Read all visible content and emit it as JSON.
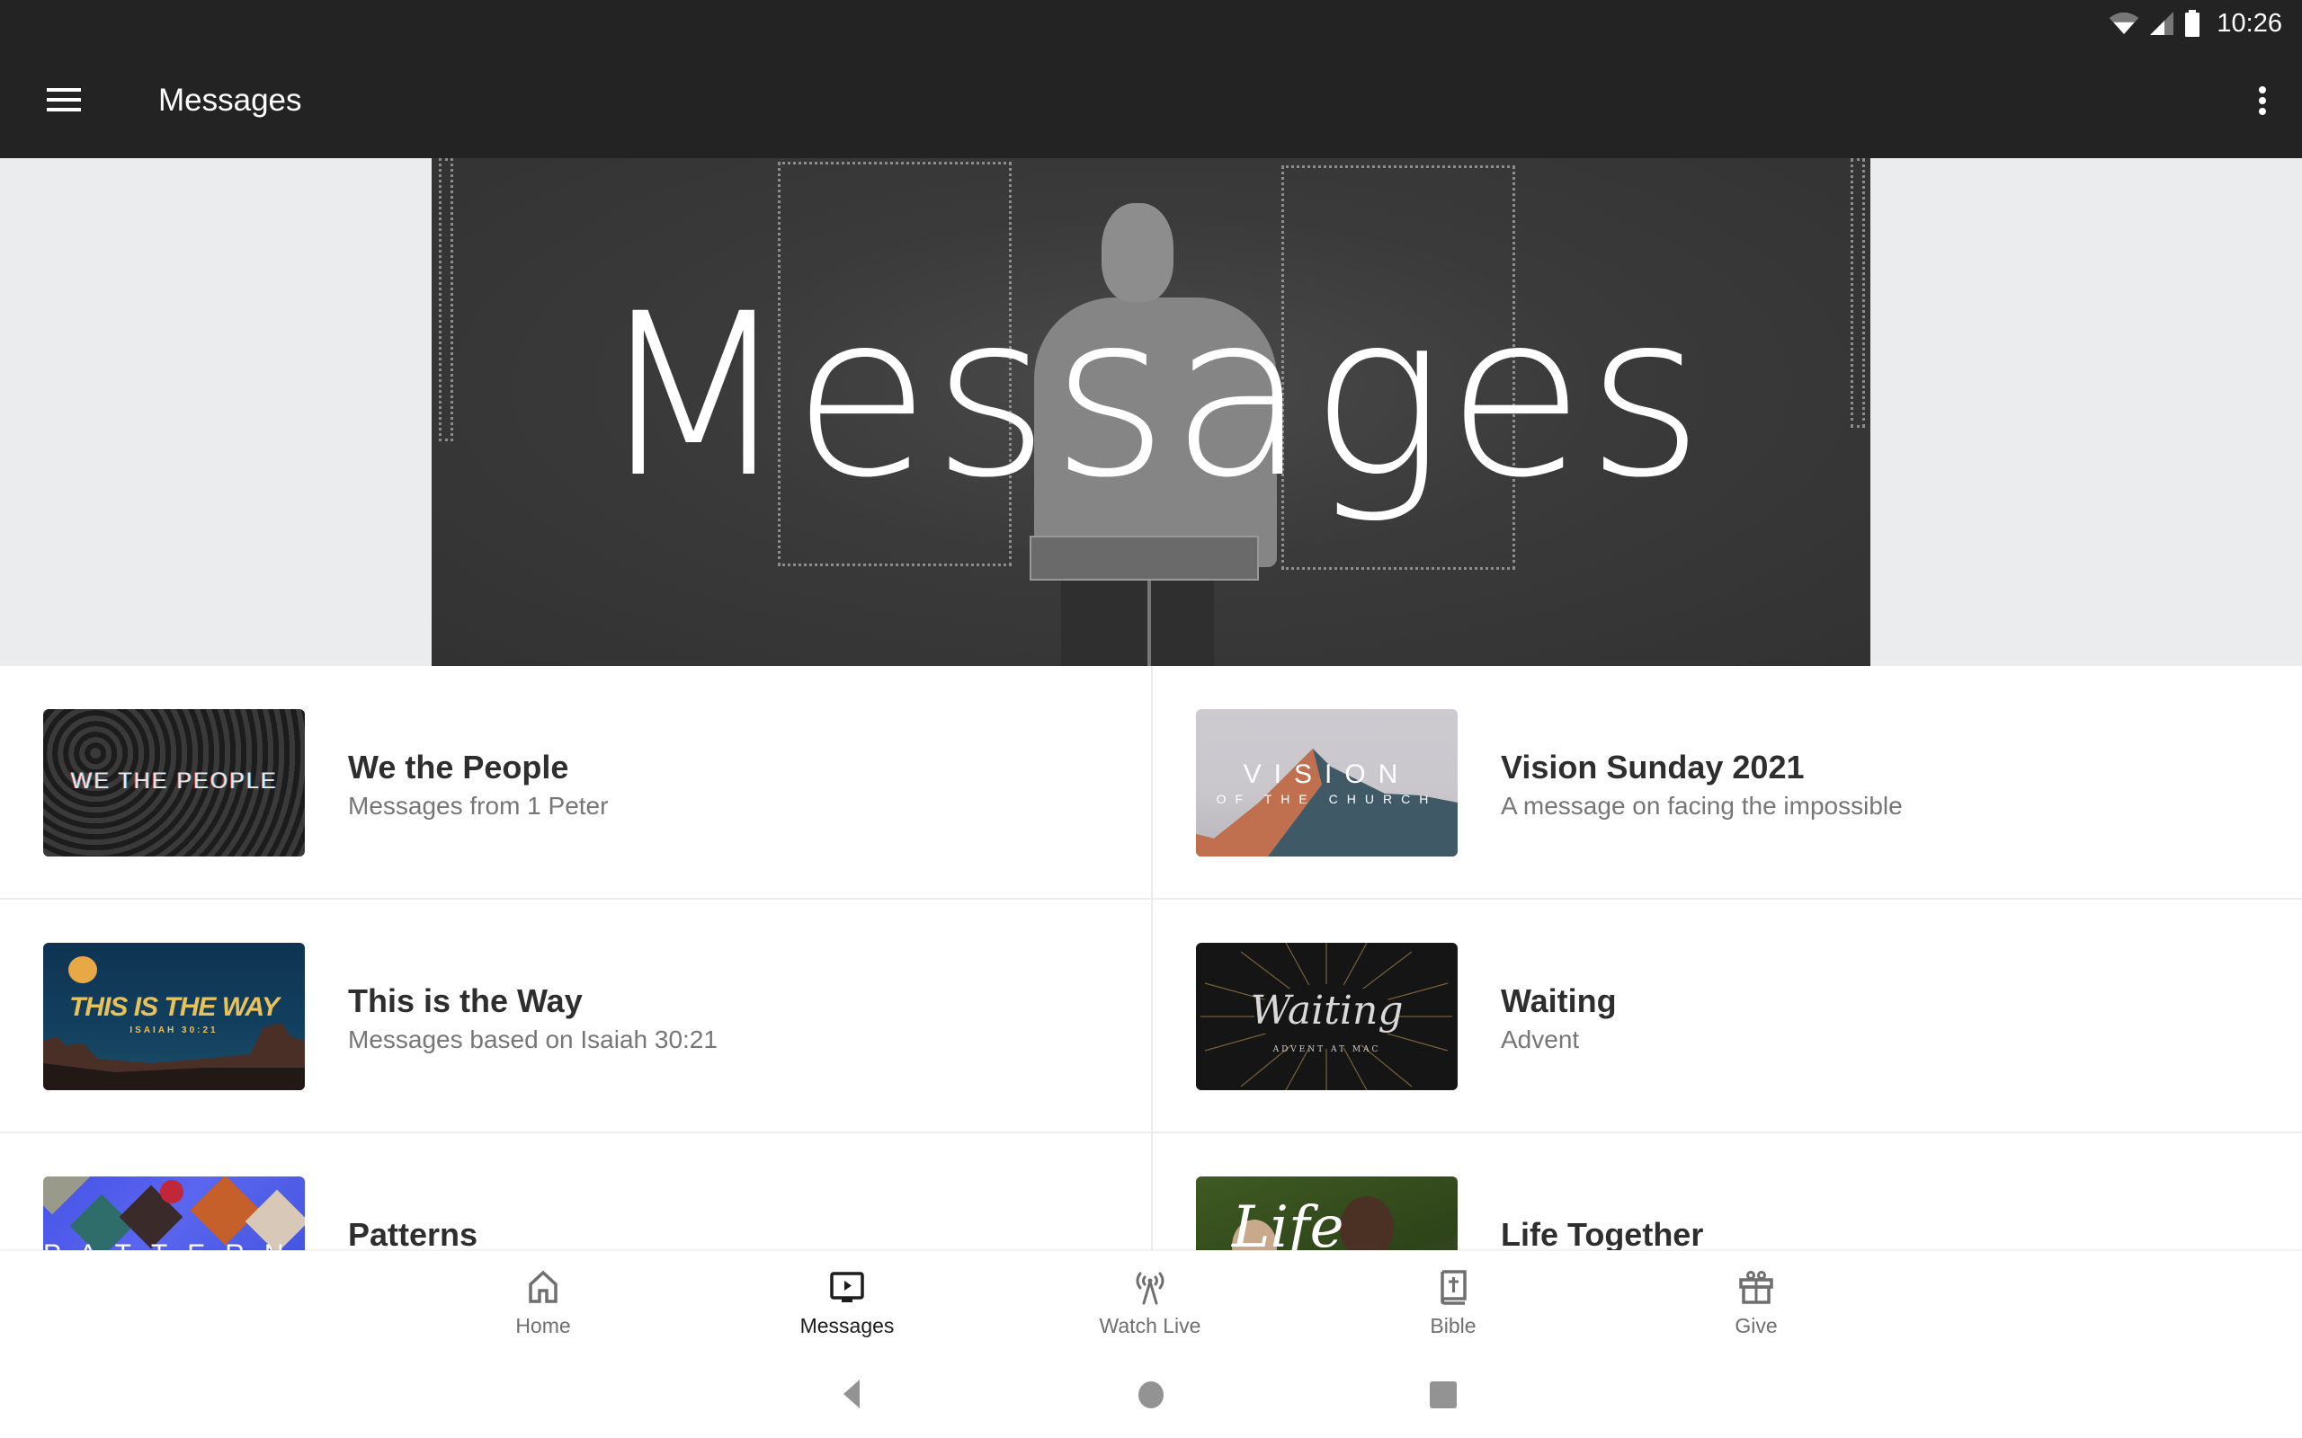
{
  "status_bar": {
    "time": "10:26",
    "icons": [
      "wifi-icon",
      "cell-signal-icon",
      "battery-icon"
    ]
  },
  "app_bar": {
    "title": "Messages",
    "menu_icon": "hamburger-menu-icon",
    "overflow_icon": "more-vert-icon"
  },
  "hero": {
    "title": "Messages"
  },
  "series": [
    {
      "title": "We the People",
      "subtitle": "Messages from 1 Peter",
      "thumb_caption": "WE THE PEOPLE"
    },
    {
      "title": "Vision Sunday 2021",
      "subtitle": "A message on facing the impossible",
      "thumb_caption": "VISION",
      "thumb_caption_2": "OF THE CHURCH"
    },
    {
      "title": "This is the Way",
      "subtitle": "Messages based on Isaiah 30:21",
      "thumb_caption": "THIS IS THE WAY",
      "thumb_caption_2": "ISAIAH 30:21"
    },
    {
      "title": "Waiting",
      "subtitle": "Advent",
      "thumb_caption": "Waiting",
      "thumb_caption_2": "ADVENT AT MAC"
    },
    {
      "title": "Patterns",
      "subtitle": "",
      "thumb_caption": "PATTERNS"
    },
    {
      "title": "Life Together",
      "subtitle": "",
      "thumb_caption": "Life"
    }
  ],
  "bottom_nav": {
    "active": "Messages",
    "items": [
      {
        "label": "Home",
        "icon": "home-icon"
      },
      {
        "label": "Messages",
        "icon": "video-play-icon"
      },
      {
        "label": "Watch Live",
        "icon": "broadcast-antenna-icon"
      },
      {
        "label": "Bible",
        "icon": "bible-icon"
      },
      {
        "label": "Give",
        "icon": "gift-icon"
      }
    ]
  },
  "system_nav": {
    "buttons": [
      "back",
      "home",
      "recents"
    ]
  },
  "colors": {
    "app_bar": "#232323",
    "hero_side_bg": "#ebecee",
    "title_text": "#2e2e2e",
    "subtitle_text": "#767676",
    "nav_inactive": "#6f6f6f",
    "nav_active": "#1d1d1d",
    "divider": "#ececec"
  }
}
